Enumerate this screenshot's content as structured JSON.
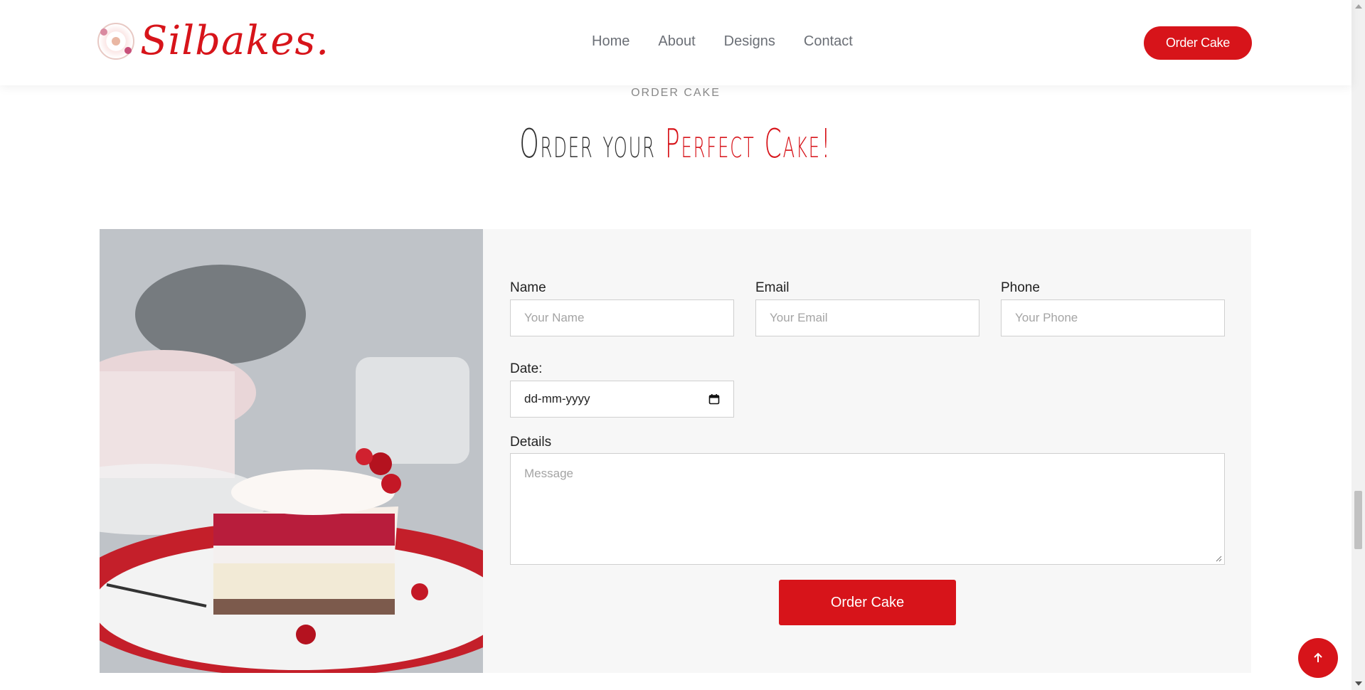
{
  "header": {
    "logo_text": "Silbakes.",
    "nav": [
      "Home",
      "About",
      "Designs",
      "Contact"
    ],
    "order_button": "Order Cake"
  },
  "section": {
    "eyebrow": "ORDER CAKE",
    "title_main": "Order your ",
    "title_accent": "Perfect Cake!"
  },
  "form": {
    "name_label": "Name",
    "name_placeholder": "Your Name",
    "email_label": "Email",
    "email_placeholder": "Your Email",
    "phone_label": "Phone",
    "phone_placeholder": "Your Phone",
    "date_label": "Date:",
    "date_value": "dd-mm-yyyy",
    "details_label": "Details",
    "details_placeholder": "Message",
    "submit_label": "Order Cake"
  },
  "icons": {
    "calendar": "calendar-icon",
    "scroll_top": "arrow-up-icon"
  },
  "colors": {
    "brand_red": "#d7141a",
    "panel_bg": "#f7f7f7"
  }
}
